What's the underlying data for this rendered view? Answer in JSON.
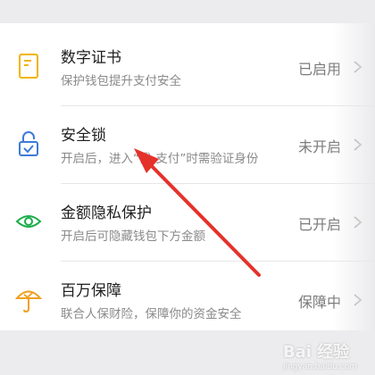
{
  "items": [
    {
      "title": "数字证书",
      "subtitle": "保护钱包提升支付安全",
      "status": "已启用",
      "icon": "certificate-icon"
    },
    {
      "title": "安全锁",
      "subtitle": "开启后，进入“我-支付”时需验证身份",
      "status": "未开启",
      "icon": "lock-icon"
    },
    {
      "title": "金额隐私保护",
      "subtitle": "开启后可隐藏钱包下方金额",
      "status": "已开启",
      "icon": "eye-icon"
    },
    {
      "title": "百万保障",
      "subtitle": "联合人保财险，保障你的资金安全",
      "status": "保障中",
      "icon": "umbrella-icon"
    }
  ],
  "watermark": {
    "main": "Bai 经验",
    "sub": "jingyan.baidu.com"
  },
  "colors": {
    "accent_yellow": "#f2b400",
    "accent_blue": "#3d7bd8",
    "accent_green": "#1aad4b",
    "accent_orange": "#f0a020",
    "arrow_red": "#e4322b"
  }
}
